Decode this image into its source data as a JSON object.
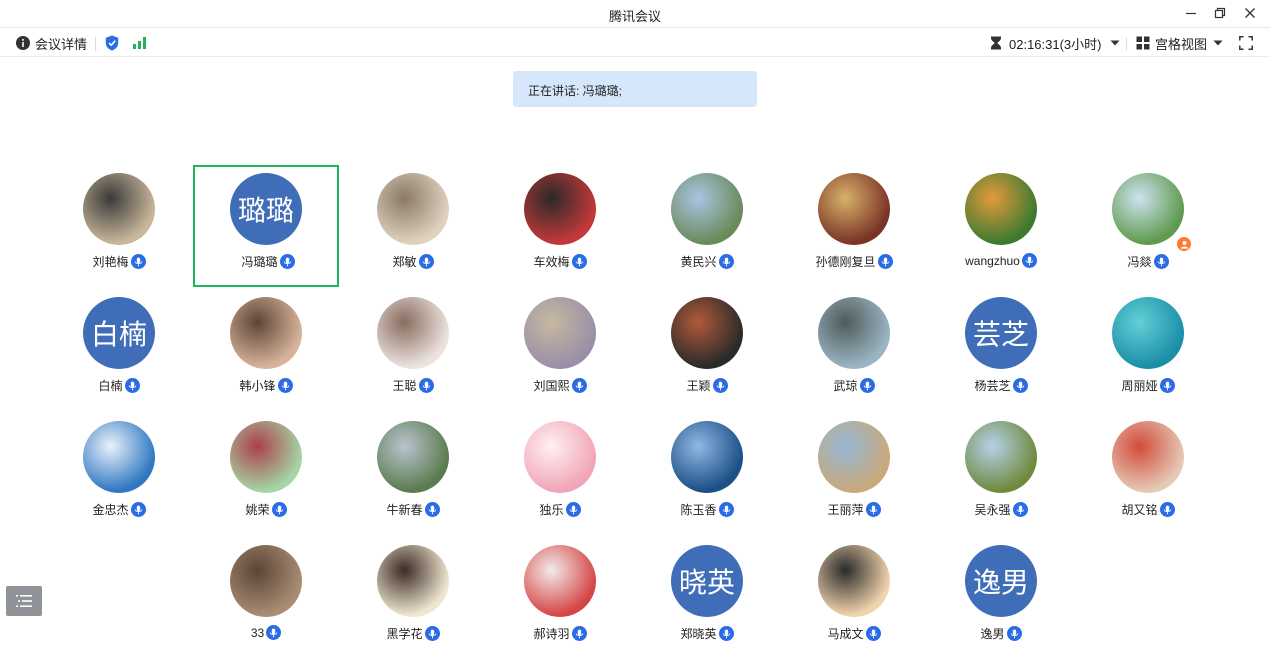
{
  "window": {
    "title": "腾讯会议"
  },
  "toolbar": {
    "details_label": "会议详情",
    "duration": "02:16:31(3小时)",
    "view_label": "宫格视图"
  },
  "banner": {
    "text": "正在讲话: 冯璐璐;"
  },
  "colors": {
    "accent": "#2a6be6",
    "speaking_border": "#22b35e",
    "banner_bg": "#d6e7fb",
    "initials_bg": "#3f6db8"
  },
  "participants": [
    {
      "name": "刘艳梅",
      "avatar": "photo"
    },
    {
      "name": "冯璐璐",
      "avatar": "initials",
      "initials": "璐璐",
      "speaking": true
    },
    {
      "name": "郑敏",
      "avatar": "photo"
    },
    {
      "name": "车效梅",
      "avatar": "photo"
    },
    {
      "name": "黄民兴",
      "avatar": "photo"
    },
    {
      "name": "孙德刚复旦",
      "avatar": "photo"
    },
    {
      "name": "wangzhuo",
      "avatar": "photo"
    },
    {
      "name": "冯燚",
      "avatar": "photo",
      "host": true
    },
    {
      "name": "白楠",
      "avatar": "initials",
      "initials": "白楠"
    },
    {
      "name": "韩小锋",
      "avatar": "photo"
    },
    {
      "name": "王聪",
      "avatar": "photo"
    },
    {
      "name": "刘国熙",
      "avatar": "photo"
    },
    {
      "name": "王颖",
      "avatar": "photo"
    },
    {
      "name": "武琼",
      "avatar": "photo"
    },
    {
      "name": "杨芸芝",
      "avatar": "initials",
      "initials": "芸芝"
    },
    {
      "name": "周丽娅",
      "avatar": "photo"
    },
    {
      "name": "金忠杰",
      "avatar": "photo"
    },
    {
      "name": "姚荣",
      "avatar": "photo"
    },
    {
      "name": "牛新春",
      "avatar": "photo"
    },
    {
      "name": "独乐",
      "avatar": "photo"
    },
    {
      "name": "陈玉香",
      "avatar": "photo"
    },
    {
      "name": "王丽萍",
      "avatar": "photo"
    },
    {
      "name": "吴永强",
      "avatar": "photo"
    },
    {
      "name": "胡又铭",
      "avatar": "photo"
    },
    {
      "name": "33",
      "avatar": "photo"
    },
    {
      "name": "黑学花",
      "avatar": "photo"
    },
    {
      "name": "郝诗羽",
      "avatar": "photo"
    },
    {
      "name": "郑晓英",
      "avatar": "initials",
      "initials": "晓英"
    },
    {
      "name": "马成文",
      "avatar": "photo"
    },
    {
      "name": "逸男",
      "avatar": "initials",
      "initials": "逸男"
    }
  ]
}
